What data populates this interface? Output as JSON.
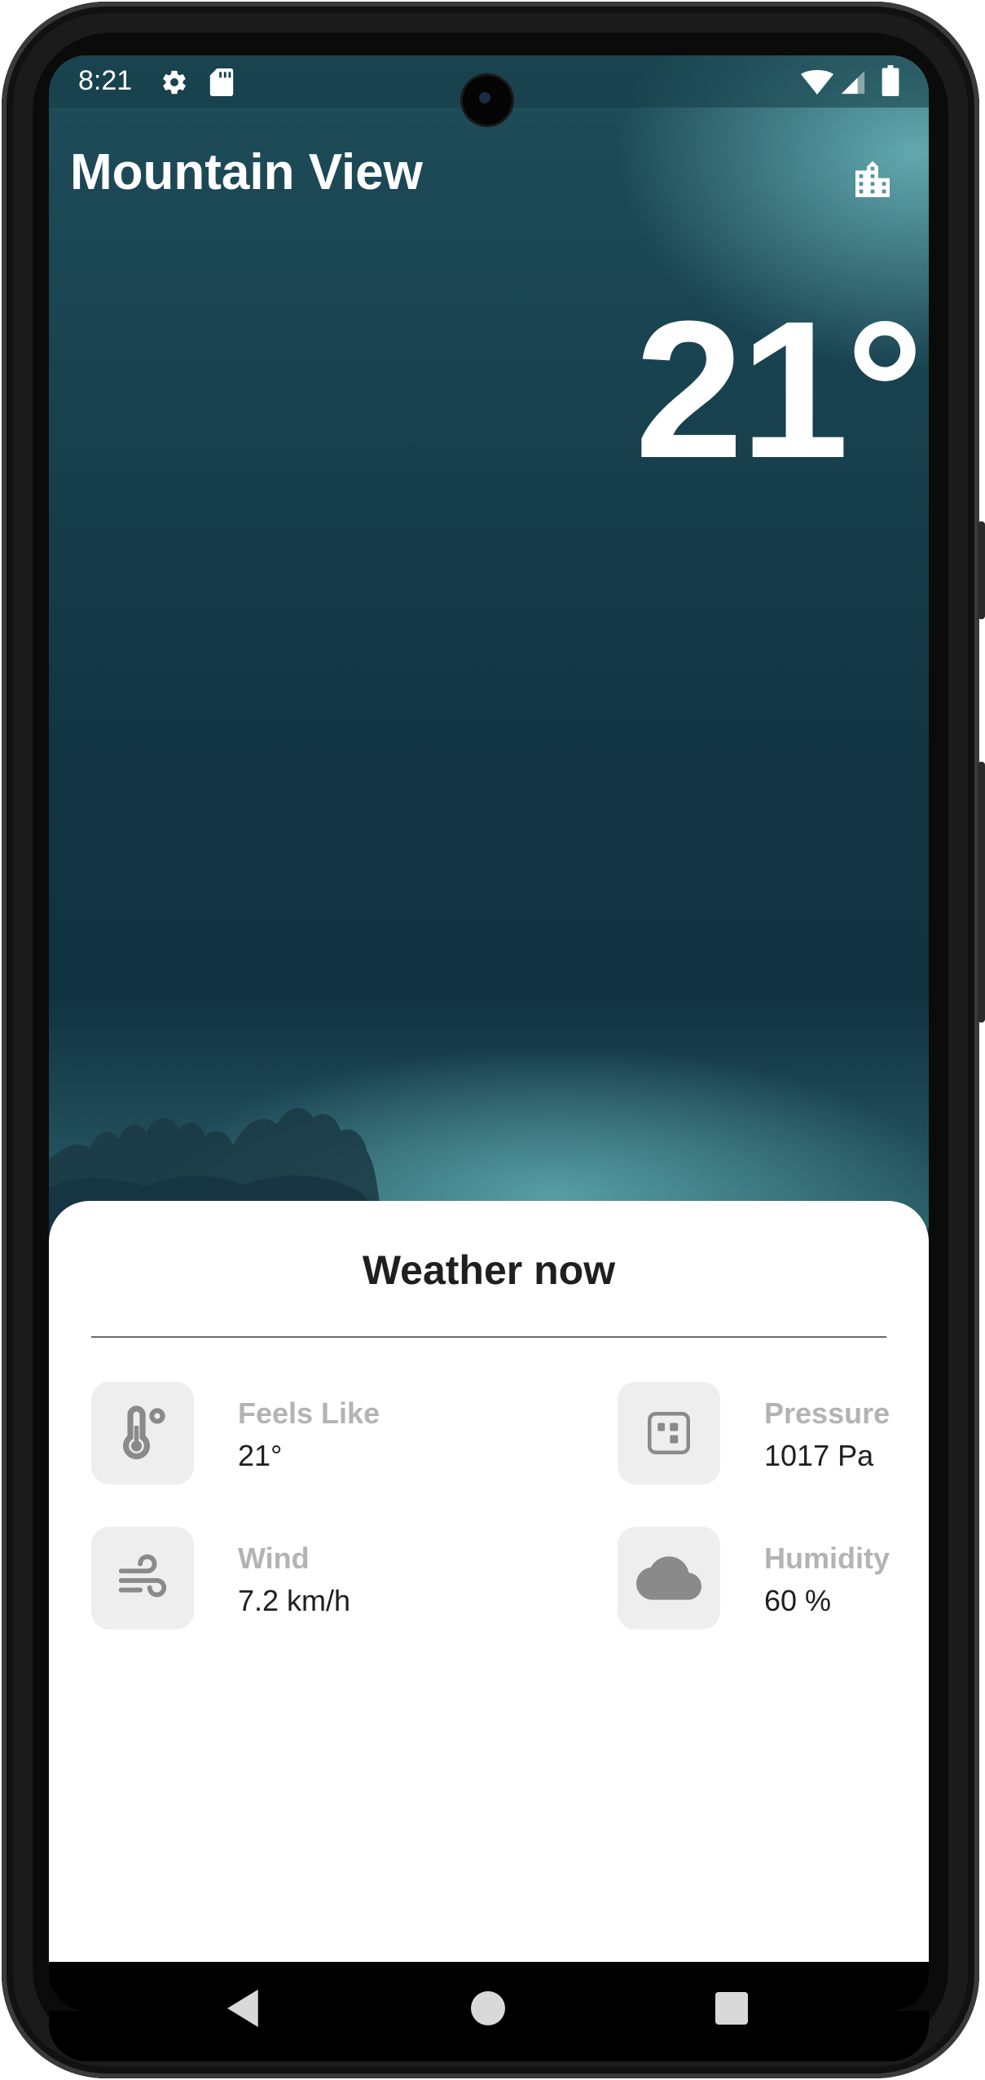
{
  "status_bar": {
    "time": "8:21",
    "icons": [
      "settings-icon",
      "sd-card-icon",
      "wifi-icon",
      "cellular-signal-icon",
      "battery-icon"
    ]
  },
  "header": {
    "city": "Mountain View",
    "city_button_icon": "city-icon"
  },
  "current": {
    "temperature": "21°"
  },
  "sheet": {
    "title": "Weather now",
    "metrics": [
      {
        "label": "Feels Like",
        "value": "21°",
        "icon": "thermometer-icon"
      },
      {
        "label": "Pressure",
        "value": "1017 Pa",
        "icon": "pressure-icon"
      },
      {
        "label": "Wind",
        "value": "7.2 km/h",
        "icon": "wind-icon"
      },
      {
        "label": "Humidity",
        "value": "60 %",
        "icon": "cloud-icon"
      }
    ]
  },
  "nav_bar": {
    "buttons": [
      "back-icon",
      "home-icon",
      "recents-icon"
    ]
  },
  "colors": {
    "sky_dark": "#113241",
    "sky_light": "#6eb9be",
    "tile_bg": "#eeeeee",
    "label_gray": "#b3b3b3",
    "icon_gray": "#8a8a8a"
  }
}
